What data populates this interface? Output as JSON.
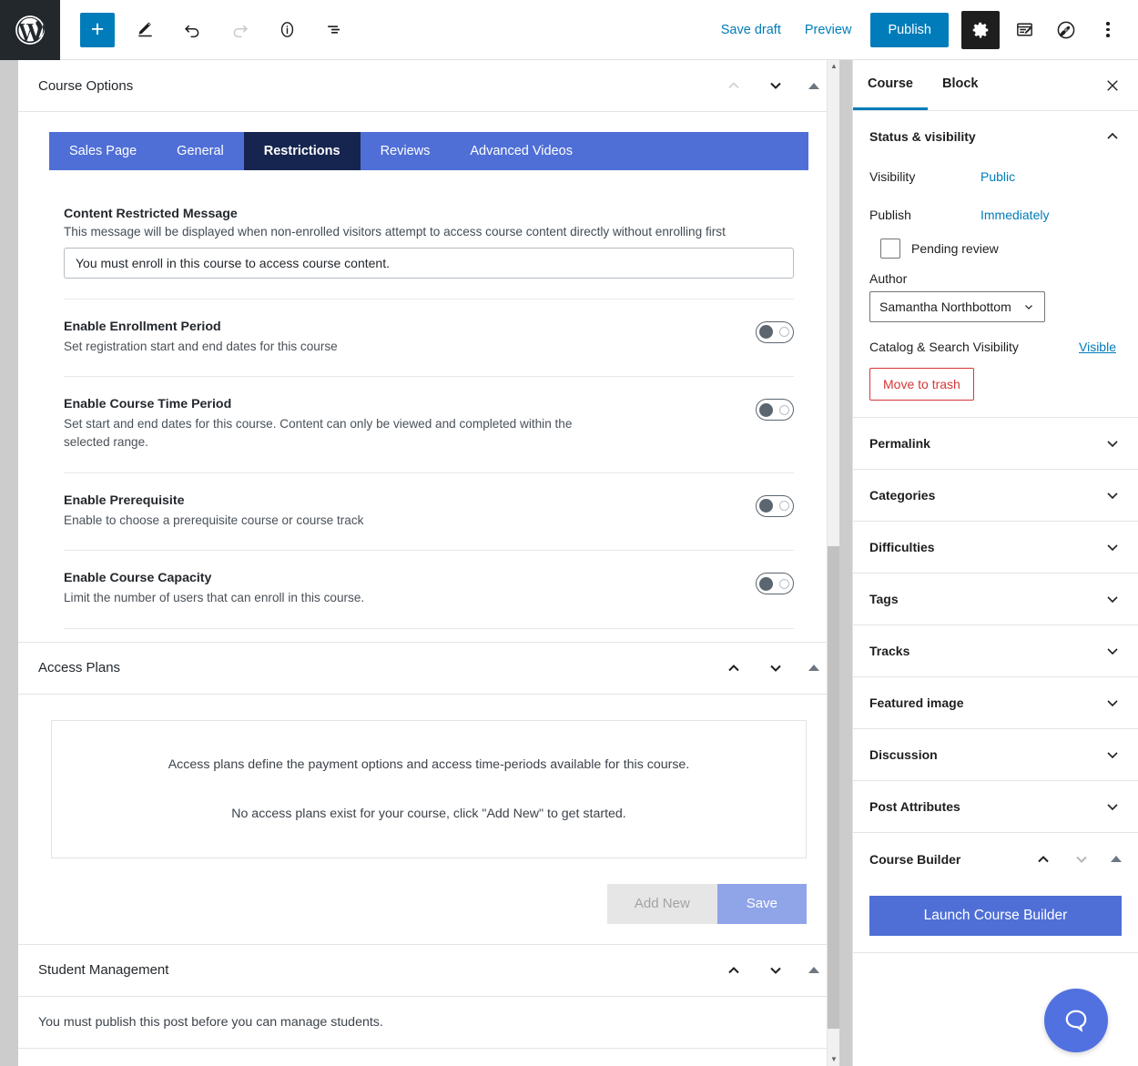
{
  "toolbar": {
    "logo_icon": "wordpress-logo-icon",
    "add_block_label": "+",
    "add_block_icon": "plus-icon",
    "edit_icon": "pencil-icon",
    "undo_icon": "undo-icon",
    "redo_icon": "redo-icon",
    "details_icon": "info-circle-icon",
    "list_view_icon": "list-view-icon",
    "save_draft_label": "Save draft",
    "preview_label": "Preview",
    "publish_label": "Publish",
    "settings_icon": "gear-icon",
    "editor_icon": "classic-editor-icon",
    "jetpack_icon": "jetpack-icon",
    "more_icon": "more-vertical-icon"
  },
  "editor": {
    "course_options": {
      "title": "Course Options",
      "collapse_up_icon": "chevron-up-icon",
      "collapse_down_icon": "chevron-down-icon",
      "toggle_icon": "triangle-up-icon",
      "tabs": [
        {
          "label": "Sales Page",
          "active": false
        },
        {
          "label": "General",
          "active": false
        },
        {
          "label": "Restrictions",
          "active": true
        },
        {
          "label": "Reviews",
          "active": false
        },
        {
          "label": "Advanced Videos",
          "active": false
        }
      ],
      "restricted_message": {
        "label": "Content Restricted Message",
        "description": "This message will be displayed when non-enrolled visitors attempt to access course content directly without enrolling first",
        "value": "You must enroll in this course to access course content.",
        "placeholder": ""
      },
      "settings": [
        {
          "title": "Enable Enrollment Period",
          "description": "Set registration start and end dates for this course",
          "enabled": false
        },
        {
          "title": "Enable Course Time Period",
          "description": "Set start and end dates for this course. Content can only be viewed and completed within the selected range.",
          "enabled": false
        },
        {
          "title": "Enable Prerequisite",
          "description": "Enable to choose a prerequisite course or course track",
          "enabled": false
        },
        {
          "title": "Enable Course Capacity",
          "description": "Limit the number of users that can enroll in this course.",
          "enabled": false
        }
      ]
    },
    "access_plans": {
      "title": "Access Plans",
      "line1": "Access plans define the payment options and access time-periods available for this course.",
      "line2": "No access plans exist for your course, click \"Add New\" to get started.",
      "add_new_label": "Add New",
      "save_label": "Save"
    },
    "student_management": {
      "title": "Student Management",
      "message": "You must publish this post before you can manage students."
    }
  },
  "sidebar": {
    "tabs": [
      {
        "label": "Course",
        "active": true
      },
      {
        "label": "Block",
        "active": false
      }
    ],
    "close_icon": "close-icon",
    "status": {
      "title": "Status & visibility",
      "visibility_label": "Visibility",
      "visibility_value": "Public",
      "publish_label": "Publish",
      "publish_value": "Immediately",
      "pending_review_label": "Pending review",
      "pending_review_checked": false,
      "author_label": "Author",
      "author_value": "Samantha Northbottom",
      "catalog_label": "Catalog & Search Visibility",
      "catalog_value": "Visible",
      "trash_label": "Move to trash"
    },
    "panels": [
      {
        "label": "Permalink"
      },
      {
        "label": "Categories"
      },
      {
        "label": "Difficulties"
      },
      {
        "label": "Tags"
      },
      {
        "label": "Tracks"
      },
      {
        "label": "Featured image"
      },
      {
        "label": "Discussion"
      },
      {
        "label": "Post Attributes"
      }
    ],
    "course_builder": {
      "title": "Course Builder",
      "launch_label": "Launch Course Builder"
    },
    "help_icon": "chat-bubble-icon"
  },
  "colors": {
    "wp_blue": "#007cba",
    "llms_blue": "#4f6fd6",
    "active_tab": "#16254f",
    "danger": "#d63638",
    "save_disabled": "#90a4e8"
  }
}
